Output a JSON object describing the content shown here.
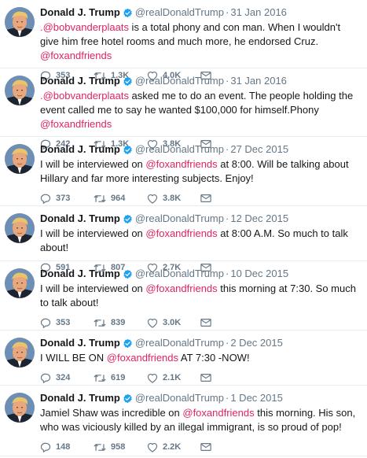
{
  "colors": {
    "mention": "#e0245e",
    "verified": "#1da1f2",
    "meta_gray": "#657786",
    "text": "#14171a",
    "divider": "#e6ecf0"
  },
  "icons": {
    "reply": "reply-icon",
    "retweet": "retweet-icon",
    "like": "heart-icon",
    "message": "envelope-icon",
    "verified": "verified-badge-icon"
  },
  "tweets": [
    {
      "name": "Donald J. Trump",
      "handle": "@realDonaldTrump",
      "date": "31 Jan 2016",
      "segments": [
        {
          "type": "mention",
          "text": ".@bobvanderplaats"
        },
        {
          "type": "text",
          "text": " is a total phony and con man. When I wouldn't give him free hotel rooms and much more, he endorsed Cruz. "
        },
        {
          "type": "mention",
          "text": "@foxandfriends"
        }
      ],
      "replies": "353",
      "retweets": "1.3K",
      "likes": "4.0K"
    },
    {
      "name": "Donald J. Trump",
      "handle": "@realDonaldTrump",
      "date": "31 Jan 2016",
      "segments": [
        {
          "type": "mention",
          "text": ".@bobvanderplaats"
        },
        {
          "type": "text",
          "text": " asked me to do an event. The people holding the event called me to say he wanted $100,000 for himself.Phony "
        },
        {
          "type": "mention",
          "text": "@foxandfriends"
        }
      ],
      "replies": "242",
      "retweets": "1.3K",
      "likes": "3.8K"
    },
    {
      "name": "Donald J. Trump",
      "handle": "@realDonaldTrump",
      "date": "27 Dec 2015",
      "segments": [
        {
          "type": "text",
          "text": "I will be interviewed on "
        },
        {
          "type": "mention",
          "text": "@foxandfriends"
        },
        {
          "type": "text",
          "text": " at 8:00. Will be talking about Hillary and far more interesting subjects. Enjoy!"
        }
      ],
      "replies": "373",
      "retweets": "964",
      "likes": "3.8K"
    },
    {
      "name": "Donald J. Trump",
      "handle": "@realDonaldTrump",
      "date": "12 Dec 2015",
      "segments": [
        {
          "type": "text",
          "text": "I will be interviewed on "
        },
        {
          "type": "mention",
          "text": "@foxandfriends"
        },
        {
          "type": "text",
          "text": " at 8:00 A.M. So much to talk about!"
        }
      ],
      "replies": "591",
      "retweets": "807",
      "likes": "2.7K"
    },
    {
      "name": "Donald J. Trump",
      "handle": "@realDonaldTrump",
      "date": "10 Dec 2015",
      "segments": [
        {
          "type": "text",
          "text": "I will be interviewed on "
        },
        {
          "type": "mention",
          "text": "@foxandfriends"
        },
        {
          "type": "text",
          "text": " this morning at 7:30. So much to talk about!"
        }
      ],
      "replies": "353",
      "retweets": "839",
      "likes": "3.0K"
    },
    {
      "name": "Donald J. Trump",
      "handle": "@realDonaldTrump",
      "date": "2 Dec 2015",
      "segments": [
        {
          "type": "text",
          "text": "I WILL BE ON "
        },
        {
          "type": "mention",
          "text": "@foxandfriends"
        },
        {
          "type": "text",
          "text": "  AT 7:30 -NOW!"
        }
      ],
      "replies": "324",
      "retweets": "619",
      "likes": "2.1K"
    },
    {
      "name": "Donald J. Trump",
      "handle": "@realDonaldTrump",
      "date": "1 Dec 2015",
      "segments": [
        {
          "type": "text",
          "text": "Jamiel Shaw was incredible on "
        },
        {
          "type": "mention",
          "text": "@foxandfriends"
        },
        {
          "type": "text",
          "text": " this morning. His son, who was viciously killed by an illegal immigrant, is so proud of pop!"
        }
      ],
      "replies": "148",
      "retweets": "958",
      "likes": "2.2K"
    }
  ]
}
